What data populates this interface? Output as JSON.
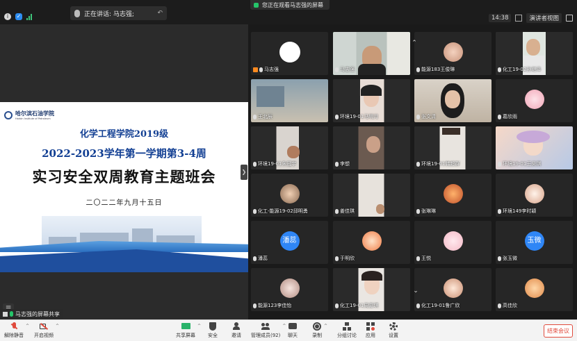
{
  "topbar": {
    "speaking_label": "正在讲话: 马志强;",
    "viewing_label": "您正在观看马志强的屏幕",
    "clock": "14:38",
    "view_mode": "演讲者视图"
  },
  "slide": {
    "logo_cn": "哈尔滨石油学院",
    "logo_en": "Harbin Institute of Petroleum",
    "line1": "化学工程学院2019级",
    "line2": "2022-2023学年第一学期第3-4周",
    "line3": "实习安全双周教育主题班会",
    "date": "二〇二二年九月十五日"
  },
  "share_label": "马志强的屏幕共享",
  "participants": [
    {
      "name": "马志强",
      "kind": "avatar-white",
      "host": true
    },
    {
      "name": "马志强",
      "kind": "video-man",
      "active": true
    },
    {
      "name": "能源183王俊琳",
      "kind": "avatar-photo"
    },
    {
      "name": "化工19-02孙继泽",
      "kind": "video-boy"
    },
    {
      "name": "王北辰",
      "kind": "video-room"
    },
    {
      "name": "环境19-01马明月",
      "kind": "video-girl"
    },
    {
      "name": "张文清",
      "kind": "video-girl2"
    },
    {
      "name": "葛欣雨",
      "kind": "avatar-photo2"
    },
    {
      "name": "环境19-01朱冠宇",
      "kind": "video-dark"
    },
    {
      "name": "李想",
      "kind": "video-dark2"
    },
    {
      "name": "环境19-01韩超群",
      "kind": "video-dark3"
    },
    {
      "name": "环境19-01王昊琪",
      "kind": "video-cartoon"
    },
    {
      "name": "化工-能源19-02邱明勇",
      "kind": "avatar-photo3"
    },
    {
      "name": "姜佳琪",
      "kind": "video-dark4"
    },
    {
      "name": "张琳琳",
      "kind": "avatar-photo4"
    },
    {
      "name": "环境149李时颖",
      "kind": "avatar-photo5"
    },
    {
      "name": "潘蕊",
      "kind": "avatar-text",
      "avatar_text": "潘蕊"
    },
    {
      "name": "于明欣",
      "kind": "avatar-photo6"
    },
    {
      "name": "王悦",
      "kind": "avatar-photo7"
    },
    {
      "name": "张玉微",
      "kind": "avatar-text",
      "avatar_text": "玉微"
    },
    {
      "name": "能源123李佳怡",
      "kind": "avatar-photo8"
    },
    {
      "name": "化工19-01周嘉琪",
      "kind": "video-girl3"
    },
    {
      "name": "化工19-01鲁广欣",
      "kind": "avatar-photo9"
    },
    {
      "name": "高佳欣",
      "kind": "avatar-photo10"
    }
  ],
  "toolbar": {
    "mute": "解除静音",
    "video": "开启视频",
    "share": "共享屏幕",
    "security": "安全",
    "invite": "邀请",
    "participants": "管理成员(92)",
    "chat": "聊天",
    "record": "录制",
    "breakout": "分组讨论",
    "apps": "应用",
    "settings": "设置",
    "leave": "结束会议"
  },
  "colors": {
    "slide_title": "#123f93",
    "active_speaker": "#2ecc71",
    "leave": "#e04a3c",
    "avatar_blue": "#2f86f6"
  }
}
